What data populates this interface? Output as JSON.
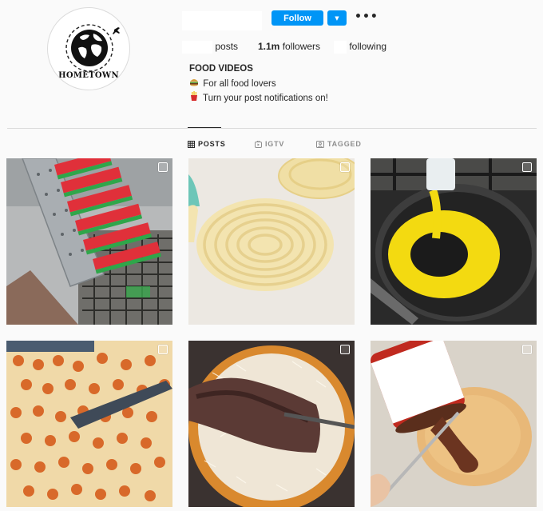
{
  "profile": {
    "avatar_text": "HOMETOWN",
    "follow_label": "Follow",
    "dropdown_glyph": "▼",
    "more_glyph": "•••",
    "stats": {
      "posts_label": "posts",
      "followers_count": "1.1m",
      "followers_label": "followers",
      "following_label": "following"
    },
    "bio": {
      "name": "FOOD VIDEOS",
      "line1_icon": "burger-icon",
      "line1": "For all food lovers",
      "line2_icon": "fries-icon",
      "line2": "Turn your post notifications on!"
    }
  },
  "tabs": [
    {
      "label": "POSTS",
      "icon": "grid-icon",
      "active": true
    },
    {
      "label": "IGTV",
      "icon": "igtv-icon",
      "active": false
    },
    {
      "label": "TAGGED",
      "icon": "tagged-icon",
      "active": false
    }
  ],
  "posts": [
    {
      "subject": "watermelon-popsicles",
      "multi": true
    },
    {
      "subject": "dough-spiral",
      "multi": true
    },
    {
      "subject": "egg-in-pan",
      "multi": true
    },
    {
      "subject": "pepperoni-pizza",
      "multi": true
    },
    {
      "subject": "cheesy-tortilla",
      "multi": true
    },
    {
      "subject": "nutella-crepe",
      "multi": true
    }
  ],
  "colors": {
    "accent": "#0095f6",
    "background": "#fafafa",
    "divider": "#dbdbdb",
    "muted_text": "#8e8e8e"
  }
}
